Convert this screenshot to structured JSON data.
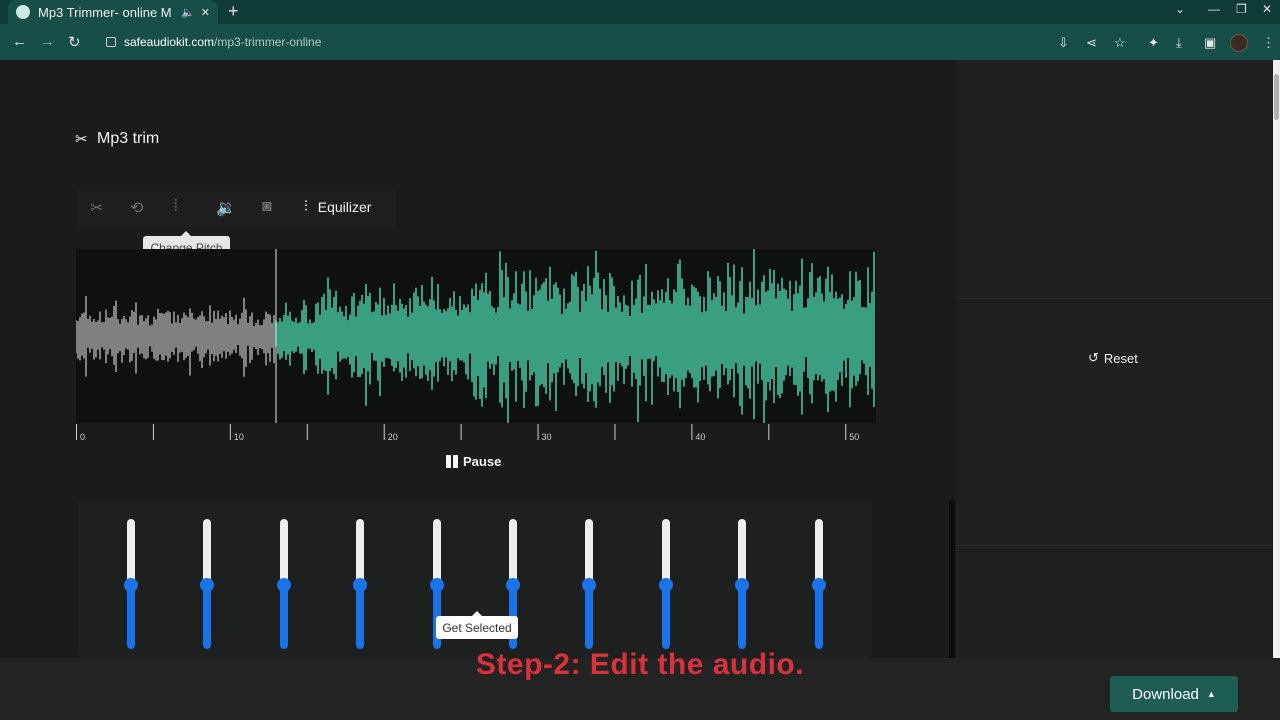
{
  "browser": {
    "tab_title": "Mp3 Trimmer- online M",
    "tab_audio_icon": "speaker-icon",
    "tab_close": "✕",
    "new_tab": "+",
    "url_host": "safeaudiokit.com",
    "url_path": "/mp3-trimmer-online"
  },
  "app": {
    "title": "Mp3 trim",
    "tools": [
      "trim",
      "change-speed",
      "change-pitch",
      "volume",
      "reverse"
    ],
    "equalizer_label": "Equilizer",
    "tooltip_change_pitch": "Change Pitch"
  },
  "waveform": {
    "ruler_labels": [
      "0",
      "10",
      "20",
      "30",
      "40",
      "50"
    ],
    "duration_seconds": 52,
    "playhead_seconds": 13,
    "colors": {
      "played": "#3a9e82",
      "unplayed": "#808080",
      "background": "#0f1111"
    }
  },
  "player": {
    "pause_label": "Pause"
  },
  "equalizer": {
    "band_count": 10,
    "band_levels": [
      0.5,
      0.5,
      0.5,
      0.5,
      0.5,
      0.5,
      0.5,
      0.5,
      0.5,
      0.5
    ],
    "tooltip_get_selected": "Get Selected"
  },
  "side_panel": {
    "reset_label": "Reset"
  },
  "footer": {
    "caption": "Step-2: Edit the audio.",
    "download_label": "Download"
  },
  "colors": {
    "accent": "#1e5e52",
    "slider_blue": "#1a73e8",
    "caption_red": "#d8323c"
  }
}
